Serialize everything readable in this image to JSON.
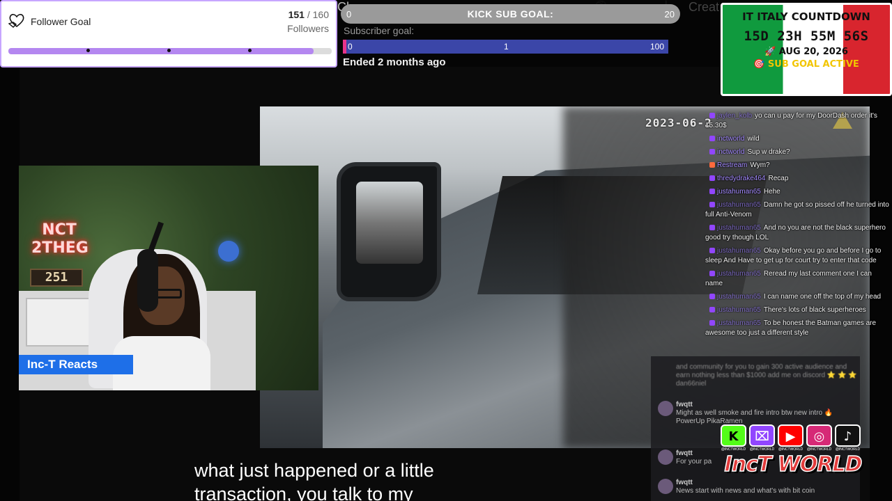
{
  "follower_goal": {
    "title": "Follower Goal",
    "current": "151",
    "separator": " / ",
    "target": "160",
    "unit": "Followers",
    "progress": 0.944,
    "accent": "#b487f0",
    "icon": "hand-heart-icon"
  },
  "kick_goal": {
    "title": "KICK SUB GOAL:",
    "min": "0",
    "max": "20",
    "color": "#9a9a9a"
  },
  "subscriber_goal": {
    "label": "Subscriber goal:",
    "min": "0",
    "current": "1",
    "max": "100",
    "status": "Ended 2 months ago",
    "bar_color": "#3b46a8",
    "marker_color": "#e8348a"
  },
  "countdown": {
    "title": "IT ITALY COUNTDOWN",
    "time": "15D 23H 55M 56S",
    "date": "🚀 AUG 20, 2026",
    "status": "🎯 SUB GOAL ACTIVE",
    "flag_colors": [
      "#109a3e",
      "#ffffff",
      "#d8252e"
    ]
  },
  "main_video": {
    "timestamp": "2023-06-2",
    "icon": "axon-logo-icon"
  },
  "webcam": {
    "badge": "Inc-T Reacts",
    "neon_sign": "NCT 2THEG",
    "neon_number": "251"
  },
  "chat": [
    {
      "icon_color": "#9146ff",
      "user": "jaylen_kolb",
      "text": "yo can u pay for my DoorDash order it's 15.30$",
      "dim": true
    },
    {
      "icon_color": "#9146ff",
      "user": "inctworld",
      "text": "wild",
      "dim": false
    },
    {
      "icon_color": "#9146ff",
      "user": "inctworld",
      "text": "Sup w drake?",
      "dim": false
    },
    {
      "icon_color": "#ff6a3d",
      "user": "Restream",
      "text": "Wym?",
      "dim": false
    },
    {
      "icon_color": "#9146ff",
      "user": "thredydrake464",
      "text": "Recap",
      "dim": false
    },
    {
      "icon_color": "#9146ff",
      "user": "justahuman65",
      "text": "Hehe",
      "dim": false
    },
    {
      "icon_color": "#9146ff",
      "user": "justahuman65",
      "text": "Damn he got so pissed off he turned into full Anti-Venom",
      "dim": true
    },
    {
      "icon_color": "#9146ff",
      "user": "justahuman65",
      "text": "And no you are not the black superhero good try though LOL",
      "dim": true
    },
    {
      "icon_color": "#9146ff",
      "user": "justahuman65",
      "text": "Okay before you go and before I go to sleep And Have to get up for court try to enter that code",
      "dim": true
    },
    {
      "icon_color": "#9146ff",
      "user": "justahuman65",
      "text": "Reread my last comment one I can name",
      "dim": true
    },
    {
      "icon_color": "#9146ff",
      "user": "justahuman65",
      "text": "I can name one off the top of my head",
      "dim": true
    },
    {
      "icon_color": "#9146ff",
      "user": "justahuman65",
      "text": "There's lots of black superheroes",
      "dim": true
    },
    {
      "icon_color": "#9146ff",
      "user": "justahuman65",
      "text": "To be honest the Batman games are awesome too just a different style",
      "dim": true
    }
  ],
  "chat2": {
    "promo": "and community for you to gain 300 active audience and earn nothing less than $1000 add me on discord ⭐ ⭐ ⭐ dan66niel",
    "messages": [
      {
        "user": "fwqtt",
        "text": "Might as well smoke and fire intro btw new intro 🔥 PowerUp PikaRamen"
      },
      {
        "user": "fwqtt",
        "text": "For your pa"
      },
      {
        "user": "fwqtt",
        "text": "News start with news and what's with bit coin"
      }
    ]
  },
  "socials": [
    {
      "icon": "kick-icon",
      "glyph": "K",
      "color": "#53fc18",
      "fg": "#000000",
      "label": "@INCTWORLD"
    },
    {
      "icon": "twitch-icon",
      "glyph": "⌧",
      "color": "#9146ff",
      "fg": "#ffffff",
      "label": "@INCTWORLD"
    },
    {
      "icon": "youtube-icon",
      "glyph": "▶",
      "color": "#ff0000",
      "fg": "#ffffff",
      "label": "@INCTWORLD"
    },
    {
      "icon": "instagram-icon",
      "glyph": "◎",
      "color": "#d62976",
      "fg": "#ffffff",
      "label": "@INCTWORLD"
    },
    {
      "icon": "tiktok-icon",
      "glyph": "♪",
      "color": "#111111",
      "fg": "#ffffff",
      "label": "@INCTWORLD"
    }
  ],
  "brand": "IncT WORLD",
  "caption": {
    "line1": "what just happened or a little",
    "line2": "transaction, you talk to my"
  },
  "ghost_ui": {
    "search": "Ch",
    "create": "Creat"
  }
}
